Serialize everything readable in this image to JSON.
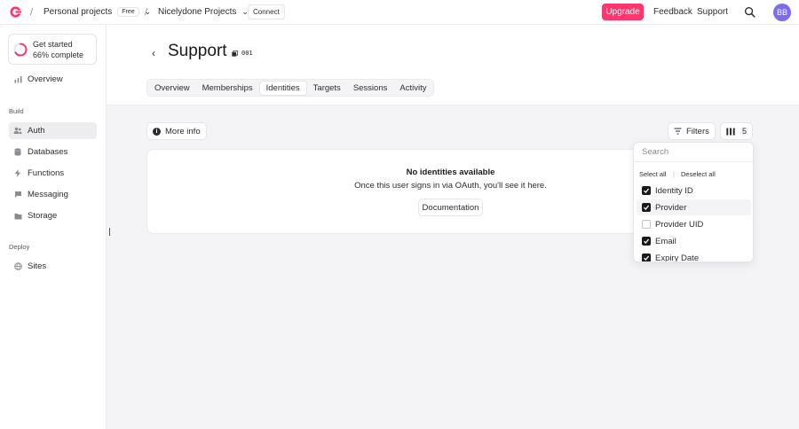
{
  "topbar": {
    "breadcrumb_org": "Personal projects",
    "plan_badge": "Free",
    "breadcrumb_project": "Nicelydone Projects",
    "connect_label": "Connect",
    "upgrade_label": "Upgrade",
    "feedback_label": "Feedback",
    "support_label": "Support",
    "avatar_initials": "BB",
    "accent_color": "#fd366e"
  },
  "sidebar": {
    "get_started_title": "Get started",
    "get_started_progress": "66% complete",
    "progress_fraction": 0.66,
    "overview_label": "Overview",
    "build_section": "Build",
    "build_items": [
      {
        "label": "Auth",
        "icon": "users-icon",
        "active": true
      },
      {
        "label": "Databases",
        "icon": "database-icon",
        "active": false
      },
      {
        "label": "Functions",
        "icon": "lightning-icon",
        "active": false
      },
      {
        "label": "Messaging",
        "icon": "chat-icon",
        "active": false
      },
      {
        "label": "Storage",
        "icon": "folder-icon",
        "active": false
      }
    ],
    "deploy_section": "Deploy",
    "deploy_items": [
      {
        "label": "Sites",
        "icon": "globe-icon",
        "active": false
      }
    ]
  },
  "header": {
    "title": "Support",
    "id_badge": "001",
    "tabs": [
      {
        "label": "Overview",
        "active": false
      },
      {
        "label": "Memberships",
        "active": false
      },
      {
        "label": "Identities",
        "active": true
      },
      {
        "label": "Targets",
        "active": false
      },
      {
        "label": "Sessions",
        "active": false
      },
      {
        "label": "Activity",
        "active": false
      }
    ]
  },
  "toolbar": {
    "more_info_label": "More info",
    "filters_label": "Filters",
    "columns_count": "5"
  },
  "empty_state": {
    "title": "No identities available",
    "description": "Once this user signs in via OAuth, you'll see it here.",
    "button_label": "Documentation"
  },
  "columns_popover": {
    "search_placeholder": "Search",
    "select_all": "Select all",
    "deselect_all": "Deselect all",
    "items": [
      {
        "label": "Identity ID",
        "checked": true
      },
      {
        "label": "Provider",
        "checked": true
      },
      {
        "label": "Provider UID",
        "checked": false
      },
      {
        "label": "Email",
        "checked": true
      },
      {
        "label": "Expiry Date",
        "checked": true
      }
    ]
  }
}
